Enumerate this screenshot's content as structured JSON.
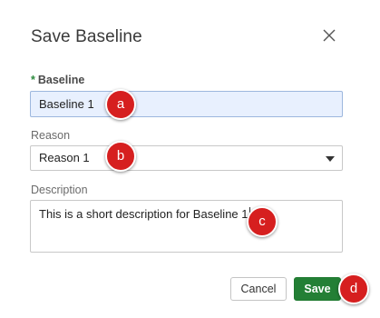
{
  "dialog": {
    "title": "Save Baseline",
    "close_icon": "close-icon"
  },
  "baseline": {
    "required_marker": "*",
    "label": "Baseline",
    "value": "Baseline 1"
  },
  "reason": {
    "label": "Reason",
    "selected": "Reason 1"
  },
  "description": {
    "label": "Description",
    "value": "This is a short description for Baseline 1"
  },
  "buttons": {
    "cancel": "Cancel",
    "save": "Save"
  },
  "callouts": {
    "a": "a",
    "b": "b",
    "c": "c",
    "d": "d",
    "color": "#d61f1f"
  },
  "colors": {
    "save_button": "#237f35",
    "input_focus_bg": "#e8f0fe",
    "required_marker": "#2e8b3e"
  }
}
